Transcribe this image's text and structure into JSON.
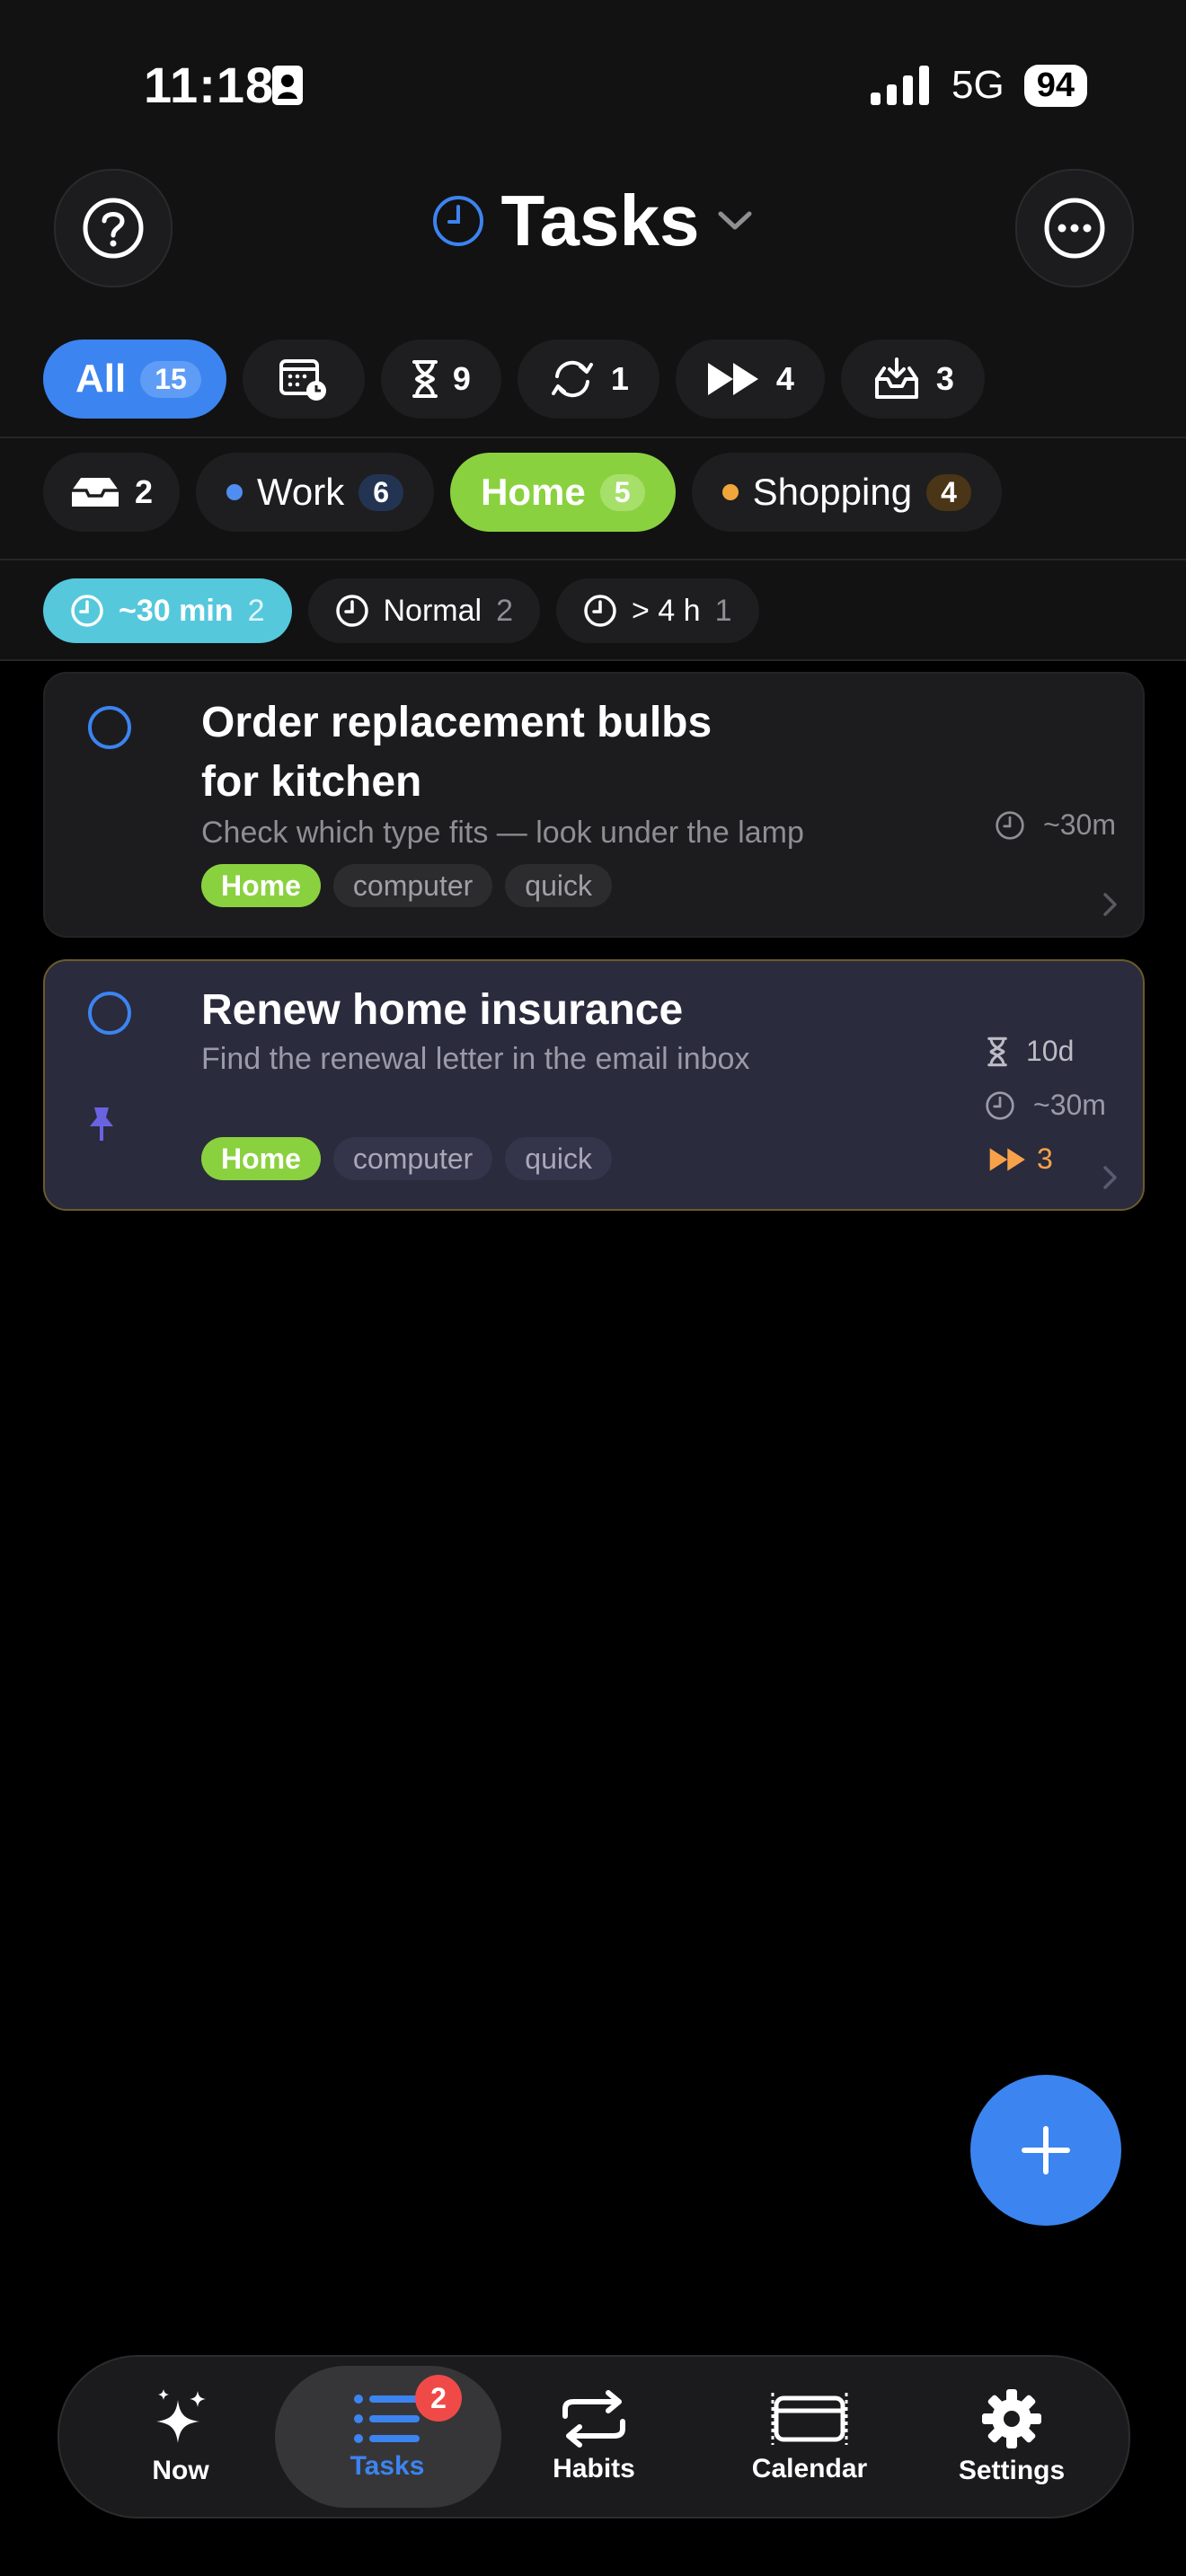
{
  "status_bar": {
    "time": "11:18",
    "network": "5G",
    "battery": "94"
  },
  "header": {
    "title": "Tasks"
  },
  "filters_row1": [
    {
      "label": "All",
      "count": "15"
    },
    {
      "icon": "calendar-clock-icon",
      "count": ""
    },
    {
      "icon": "hourglass-icon",
      "count": "9"
    },
    {
      "icon": "repeat-icon",
      "count": "1"
    },
    {
      "icon": "fast-forward-icon",
      "count": "4"
    },
    {
      "icon": "inbox-tray-icon",
      "count": "3"
    }
  ],
  "filters_row2": [
    {
      "icon": "inbox-icon",
      "count": "2"
    },
    {
      "label": "Work",
      "count": "6",
      "color": "#4f8ef0"
    },
    {
      "label": "Home",
      "count": "5",
      "color": "#8ad13f"
    },
    {
      "label": "Shopping",
      "count": "4",
      "color": "#f0a63a"
    }
  ],
  "filters_row3": [
    {
      "label": "~30 min",
      "count": "2"
    },
    {
      "label": "Normal",
      "count": "2"
    },
    {
      "label": "> 4 h",
      "count": "1"
    }
  ],
  "tasks": [
    {
      "title_line1": "Order replacement bulbs",
      "title_line2": "for kitchen",
      "subtitle": "Check which type fits — look under the lamp",
      "tags": [
        "Home",
        "computer",
        "quick"
      ],
      "duration": "~30m"
    },
    {
      "title": "Renew home insurance",
      "subtitle": "Find the renewal letter in the email inbox",
      "tags": [
        "Home",
        "computer",
        "quick"
      ],
      "due": "10d",
      "duration": "~30m",
      "priority": "3"
    }
  ],
  "tabbar": {
    "items": [
      {
        "label": "Now"
      },
      {
        "label": "Tasks",
        "badge": "2"
      },
      {
        "label": "Habits"
      },
      {
        "label": "Calendar"
      },
      {
        "label": "Settings"
      }
    ]
  },
  "colors": {
    "accent": "#3c84f0",
    "home": "#8ad13f",
    "cyan": "#55c8dc",
    "orange": "#f7a24b"
  }
}
